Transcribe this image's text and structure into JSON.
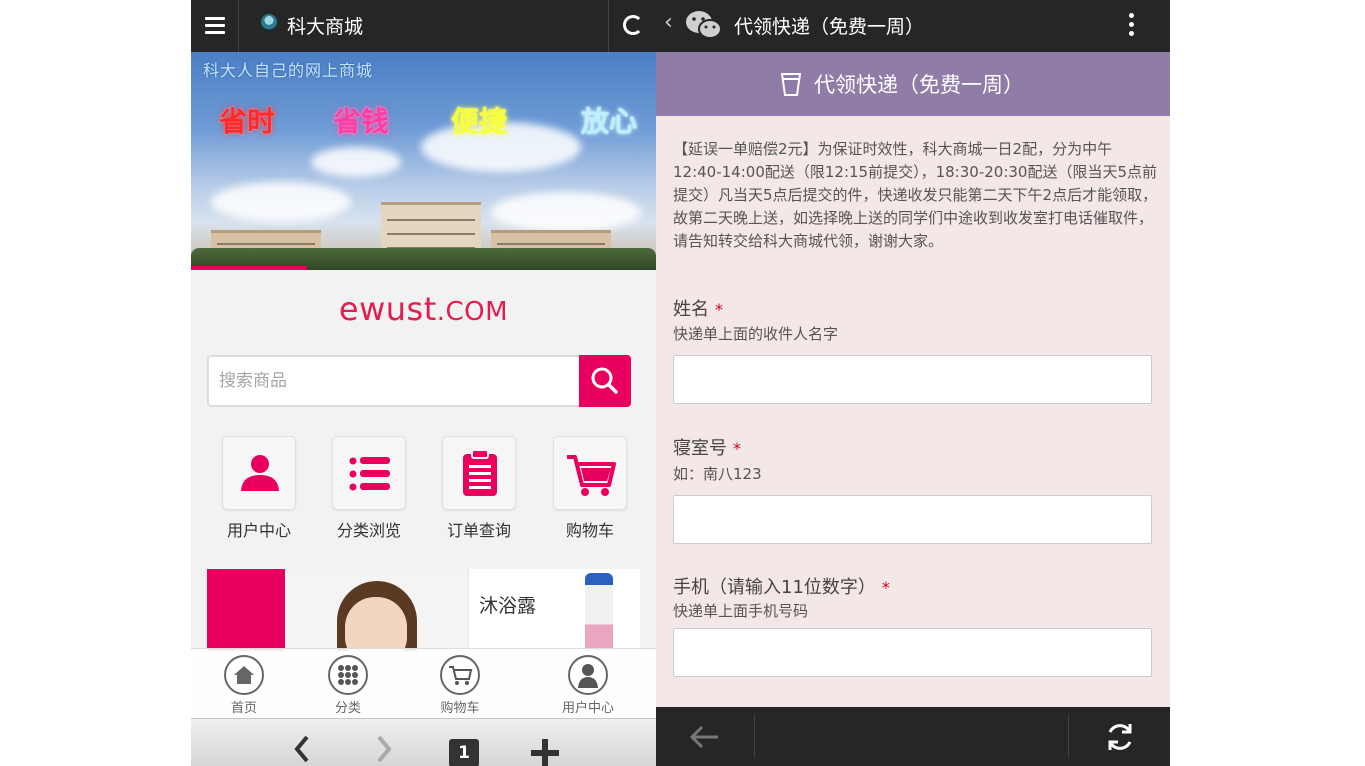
{
  "left": {
    "top_bar": {
      "title": "科大商城"
    },
    "banner": {
      "slogan": "科大人自己的网上商城",
      "keywords": [
        {
          "text": "省时",
          "color": "#ff2a2a"
        },
        {
          "text": "省钱",
          "color": "#ff3ea5"
        },
        {
          "text": "便捷",
          "color": "#f6ff3a"
        },
        {
          "text": "放心",
          "color": "#bfefff"
        }
      ],
      "progress": 0.25
    },
    "site_logo": {
      "main": "ewust",
      "suffix": ".COM"
    },
    "search": {
      "placeholder": "搜索商品"
    },
    "quick_links": [
      {
        "label": "用户中心",
        "icon": "user-icon"
      },
      {
        "label": "分类浏览",
        "icon": "list-icon"
      },
      {
        "label": "订单查询",
        "icon": "clipboard-icon"
      },
      {
        "label": "购物车",
        "icon": "cart-icon"
      }
    ],
    "product_strip": {
      "product_name": "沐浴露"
    },
    "bottom_nav": [
      {
        "label": "首页",
        "icon": "home-icon"
      },
      {
        "label": "分类",
        "icon": "grid-icon"
      },
      {
        "label": "购物车",
        "icon": "cart-icon"
      },
      {
        "label": "用户中心",
        "icon": "user-icon"
      }
    ],
    "browser_bar": {
      "tab_count": "1"
    }
  },
  "right": {
    "top_bar": {
      "back": "‹",
      "title": "代领快递（免费一周）"
    },
    "header": {
      "title": "代领快递（免费一周）"
    },
    "notice": "【延误一单赔偿2元】为保证时效性，科大商城一日2配，分为中午12:40-14:00配送（限12:15前提交），18:30-20:30配送（限当天5点前提交）凡当天5点后提交的件，快递收发只能第二天下午2点后才能领取，故第二天晚上送，如选择晚上送的同学们中途收到收发室打电话催取件，请告知转交给科大商城代领，谢谢大家。",
    "fields": [
      {
        "label": "姓名",
        "required": "*",
        "hint": "快递单上面的收件人名字",
        "value": ""
      },
      {
        "label": "寝室号",
        "required": "*",
        "hint": "如：南八123",
        "value": ""
      },
      {
        "label": "手机（请输入11位数字）",
        "required": "*",
        "hint": "快递单上面手机号码",
        "value": ""
      }
    ]
  },
  "colors": {
    "accent": "#e9005e",
    "header_purple": "#8f7da7",
    "logo_red": "#e01f4f",
    "dark_bar": "#262626"
  }
}
